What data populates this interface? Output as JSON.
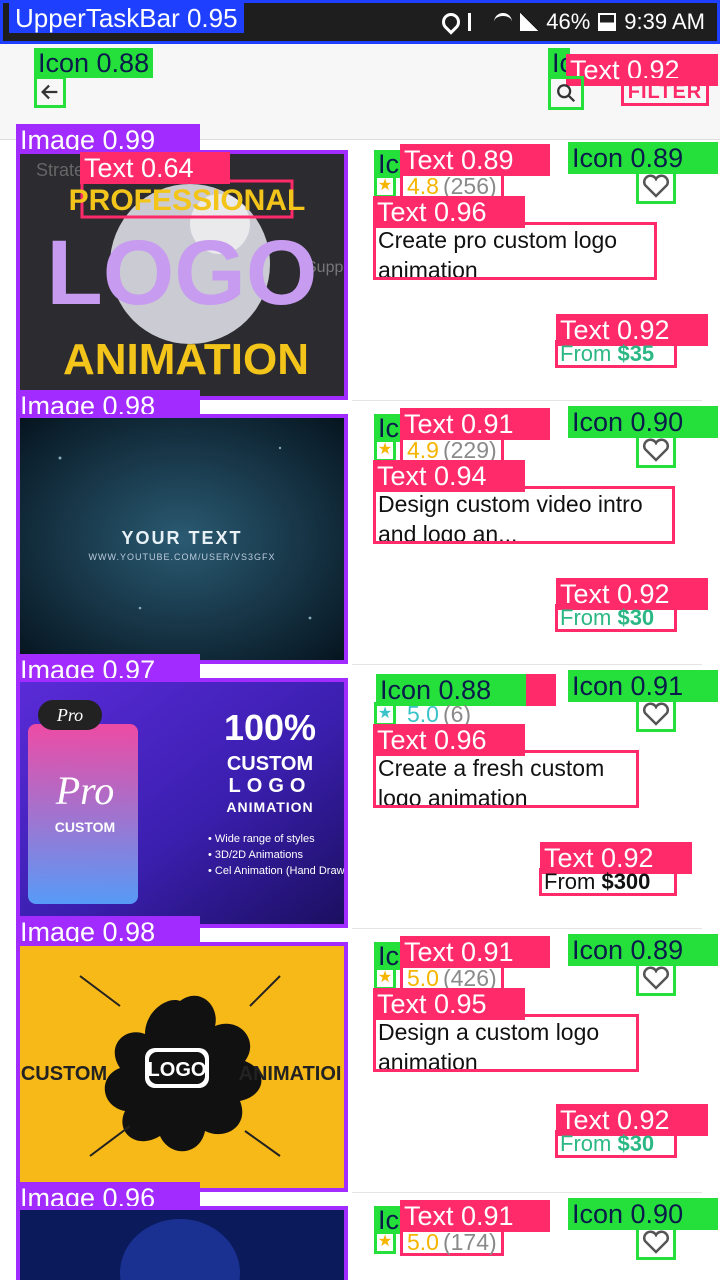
{
  "status_bar": {
    "label": "UpperTaskBar 0.95",
    "battery": "46%",
    "time": "9:39 AM"
  },
  "toolbar": {
    "back_label": "Icon 0.88",
    "search_label": "Icon 0.88",
    "filter": "FILTER",
    "filter_label": "Text 0.92",
    "search_icon": "search-icon",
    "back_icon": "arrow-left-icon"
  },
  "gigs": [
    {
      "image_label": "Image 0.99",
      "overlay_label": "Text 0.64",
      "image_text": [
        "PROFESSIONAL",
        "LOGO",
        "ANIMATION"
      ],
      "rating_icon_label": "Icon",
      "rating_text_label": "Text 0.89",
      "rating": "4.8",
      "reviews": "(256)",
      "fav_label": "Icon 0.89",
      "title_label": "Text 0.96",
      "title": "Create pro custom logo animation",
      "price_label": "Text 0.92",
      "from": "From",
      "price": "$35"
    },
    {
      "image_label": "Image 0.98",
      "image_text": [
        "YOUR TEXT",
        "WWW.YOUTUBE.COM/USER/VS3GFX"
      ],
      "rating_icon_label": "Icon",
      "rating_text_label": "Text 0.91",
      "rating": "4.9",
      "reviews": "(229)",
      "fav_label": "Icon 0.90",
      "title_label": "Text 0.94",
      "title": "Design custom video intro and  logo an...",
      "price_label": "Text 0.92",
      "from": "From",
      "price": "$30"
    },
    {
      "image_label": "Image 0.97",
      "image_text": [
        "Pro",
        "100%",
        "CUSTOM",
        "LOGO",
        "ANIMATION",
        "• Wide range of styles",
        "• 3D/2D Animations",
        "• Cel Animation (Hand Draw"
      ],
      "rating_icon_label": "Icon 0.88",
      "rating_text_label": "9",
      "rating": "5.0",
      "reviews": "(6)",
      "fav_label": "Icon 0.91",
      "title_label": "Text 0.96",
      "title": "Create a fresh custom logo animation",
      "price_label": "Text 0.92",
      "from": "From",
      "price": "$300"
    },
    {
      "image_label": "Image 0.98",
      "image_text": [
        "CUSTOM",
        "LOGO",
        "ANIMATIOI"
      ],
      "rating_icon_label": "Icon",
      "rating_text_label": "Text 0.91",
      "rating": "5.0",
      "reviews": "(426)",
      "fav_label": "Icon 0.89",
      "title_label": "Text 0.95",
      "title": "Design a custom logo animation",
      "price_label": "Text 0.92",
      "from": "From",
      "price": "$30"
    },
    {
      "image_label": "Image 0.96",
      "rating_icon_label": "Icon",
      "rating_text_label": "Text 0.91",
      "rating": "5.0",
      "reviews": "(174)",
      "fav_label": "Icon 0.90"
    }
  ],
  "colors": {
    "icon_box": "#25e03a",
    "text_box": "#ff2a6a",
    "image_box": "#a22bff",
    "price_green": "#2cb884",
    "rating_gold": "#f5b400"
  }
}
